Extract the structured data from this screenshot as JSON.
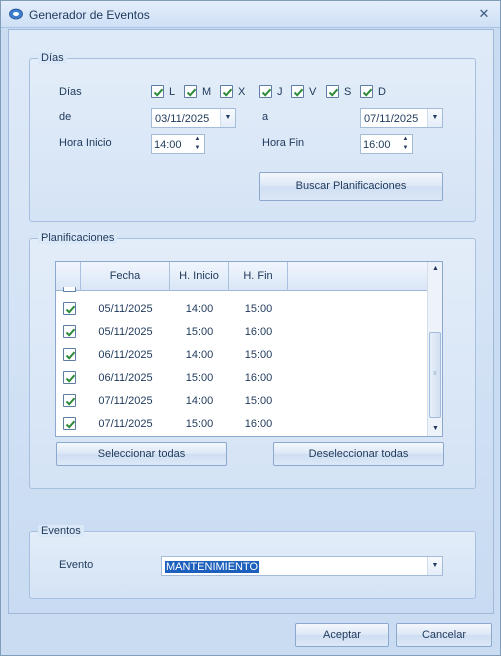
{
  "window": {
    "title": "Generador de Eventos",
    "close_symbol": "✕"
  },
  "dias_group": {
    "title": "Días",
    "days_label": "Días",
    "days": [
      {
        "label": "L",
        "checked": true
      },
      {
        "label": "M",
        "checked": true
      },
      {
        "label": "X",
        "checked": true
      },
      {
        "label": "J",
        "checked": true
      },
      {
        "label": "V",
        "checked": true
      },
      {
        "label": "S",
        "checked": true
      },
      {
        "label": "D",
        "checked": true
      }
    ],
    "from_label": "de",
    "from_date": "03/11/2025",
    "to_label": "a",
    "to_date": "07/11/2025",
    "start_label": "Hora Inicio",
    "start_time": "14:00",
    "end_label": "Hora Fin",
    "end_time": "16:00",
    "search_button": "Buscar Planificaciones"
  },
  "planificaciones": {
    "title": "Planificaciones",
    "columns": [
      "Fecha",
      "H. Inicio",
      "H. Fin"
    ],
    "rows": [
      {
        "fecha": "05/11/2025",
        "inicio": "14:00",
        "fin": "15:00",
        "checked": true
      },
      {
        "fecha": "05/11/2025",
        "inicio": "15:00",
        "fin": "16:00",
        "checked": true
      },
      {
        "fecha": "06/11/2025",
        "inicio": "14:00",
        "fin": "15:00",
        "checked": true
      },
      {
        "fecha": "06/11/2025",
        "inicio": "15:00",
        "fin": "16:00",
        "checked": true
      },
      {
        "fecha": "07/11/2025",
        "inicio": "14:00",
        "fin": "15:00",
        "checked": true
      },
      {
        "fecha": "07/11/2025",
        "inicio": "15:00",
        "fin": "16:00",
        "checked": true
      }
    ],
    "select_all": "Seleccionar todas",
    "deselect_all": "Deseleccionar todas"
  },
  "eventos": {
    "title": "Eventos",
    "event_label": "Evento",
    "event_value": "MANTENIMIENTO"
  },
  "footer": {
    "accept": "Aceptar",
    "cancel": "Cancelar"
  },
  "colors": {
    "accent": "#1c5fbd",
    "check": "#2e8b3a",
    "background": "#c9dcf2"
  }
}
